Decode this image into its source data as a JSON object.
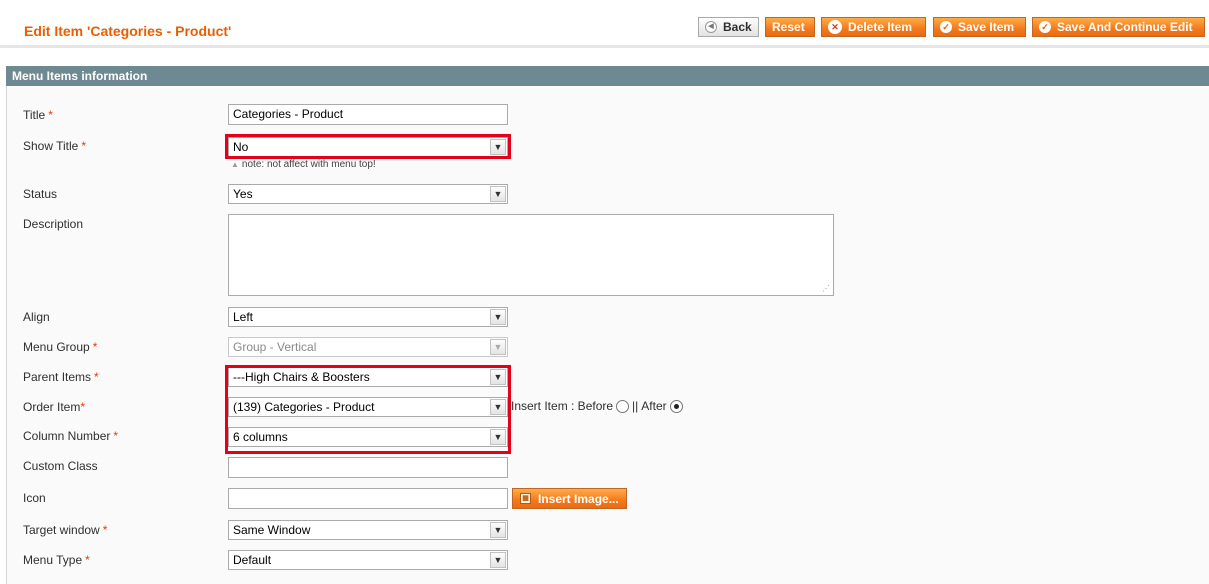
{
  "header": {
    "title": "Edit Item 'Categories - Product'",
    "buttons": {
      "back": "Back",
      "reset": "Reset",
      "delete": "Delete Item",
      "save": "Save Item",
      "save_continue": "Save And Continue Edit"
    }
  },
  "section": {
    "title": "Menu Items information"
  },
  "fields": {
    "title": {
      "label": "Title",
      "value": "Categories - Product"
    },
    "show_title": {
      "label": "Show Title",
      "value": "No",
      "note": "note: not affect with menu top!"
    },
    "status": {
      "label": "Status",
      "value": "Yes"
    },
    "description": {
      "label": "Description",
      "value": ""
    },
    "align": {
      "label": "Align",
      "value": "Left"
    },
    "menu_group": {
      "label": "Menu Group",
      "value": "Group - Vertical"
    },
    "parent_items": {
      "label": "Parent Items",
      "value": "---High Chairs & Boosters"
    },
    "order_item": {
      "label": "Order Item",
      "value": "(139) Categories - Product",
      "insert_label": "Insert Item : Before",
      "separator": "||",
      "after_label": "After"
    },
    "column_number": {
      "label": "Column Number",
      "value": "6 columns"
    },
    "custom_class": {
      "label": "Custom Class",
      "value": ""
    },
    "icon": {
      "label": "Icon",
      "value": "",
      "button": "Insert Image..."
    },
    "target_window": {
      "label": "Target window",
      "value": "Same Window"
    },
    "menu_type": {
      "label": "Menu Type",
      "value": "Default"
    }
  },
  "required_marker": "*",
  "colors": {
    "accent": "#eb5e00",
    "section_bar": "#6f8992",
    "highlight": "#e3001b"
  },
  "icons": {
    "select_arrow": "chevron-down-icon"
  }
}
